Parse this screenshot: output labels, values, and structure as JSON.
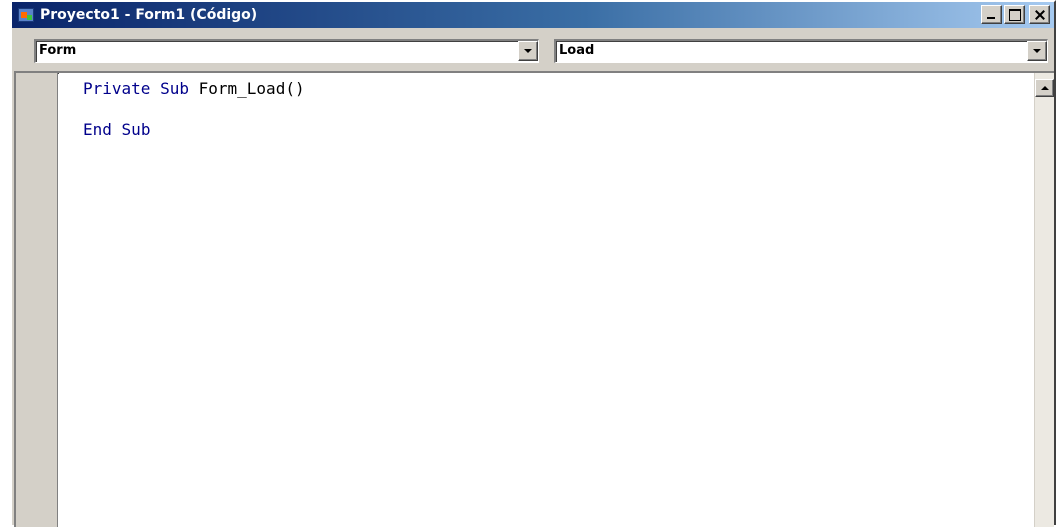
{
  "window": {
    "title": "Proyecto1 - Form1 (Código)",
    "icon": "vb-project-icon"
  },
  "object_combo": {
    "selected": "Form",
    "icon": "chevron-down-icon"
  },
  "procedure_combo": {
    "selected": "Load",
    "icon": "chevron-down-icon"
  },
  "code": {
    "line1": {
      "keyword1": "Private",
      "keyword2": "Sub",
      "name": "Form_Load()"
    },
    "line2": {
      "keyword1": "End",
      "keyword2": "Sub"
    }
  },
  "colors": {
    "keyword": "#00008b",
    "identifier": "#000000",
    "title_bar_start": "#0a246a",
    "title_bar_end": "#a6caf0",
    "chrome": "#d4d0c8"
  }
}
